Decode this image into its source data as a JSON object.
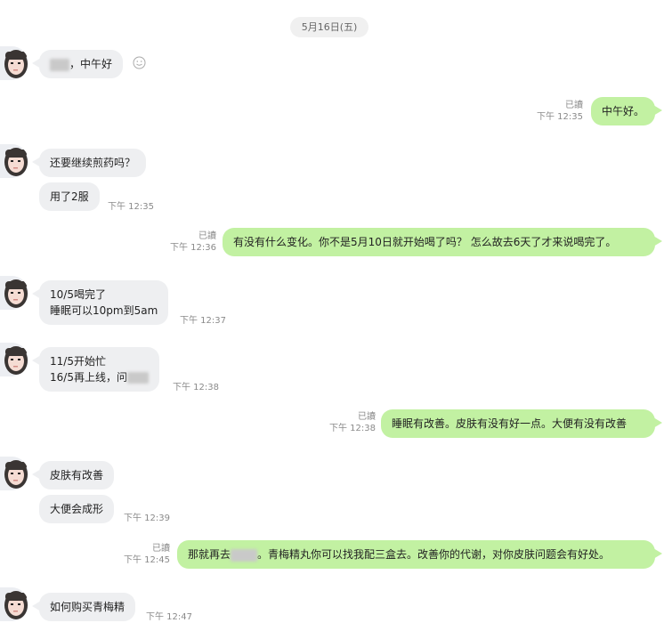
{
  "chat": {
    "date": "5月16日(五)",
    "messages": [
      {
        "side": "in",
        "text": "，中午好"
      },
      {
        "side": "out",
        "read": "已讀",
        "time": "下午 12:35",
        "text": "中午好。"
      },
      {
        "side": "in",
        "text": "还要继续煎药吗？"
      },
      {
        "side": "in",
        "text": "用了2服",
        "time": "下午 12:35"
      },
      {
        "side": "out",
        "read": "已讀",
        "time": "下午 12:36",
        "text": "有没有什么变化。你不是5月10日就开始喝了吗？ 怎么故去6天了才来说喝完了。"
      },
      {
        "side": "in",
        "lines": [
          "10/5喝完了",
          "睡眠可以10pm到5am"
        ],
        "time": "下午 12:37"
      },
      {
        "side": "in",
        "lines": [
          "11/5开始忙",
          "16/5再上线，问"
        ],
        "time": "下午 12:38"
      },
      {
        "side": "out",
        "read": "已讀",
        "time": "下午 12:38",
        "text": "睡眠有改善。皮肤有没有好一点。大便有没有改善"
      },
      {
        "side": "in",
        "text": "皮肤有改善"
      },
      {
        "side": "in",
        "text": "大便会成形",
        "time": "下午 12:39"
      },
      {
        "side": "out",
        "read": "已讀",
        "time": "下午 12:45",
        "text_a": "那就再去",
        "text_b": "。青梅精丸你可以找我配三盒去。改善你的代谢，对你皮肤问题会有好处。"
      },
      {
        "side": "in",
        "text": "如何购买青梅精",
        "time": "下午 12:47"
      }
    ]
  },
  "colors": {
    "outgoing": "#c2f1a2",
    "incoming": "#eeeff1",
    "meta": "#8a8a8a"
  },
  "icons": {
    "avatar": "avatar-icon",
    "emoji": "smiley-icon"
  }
}
